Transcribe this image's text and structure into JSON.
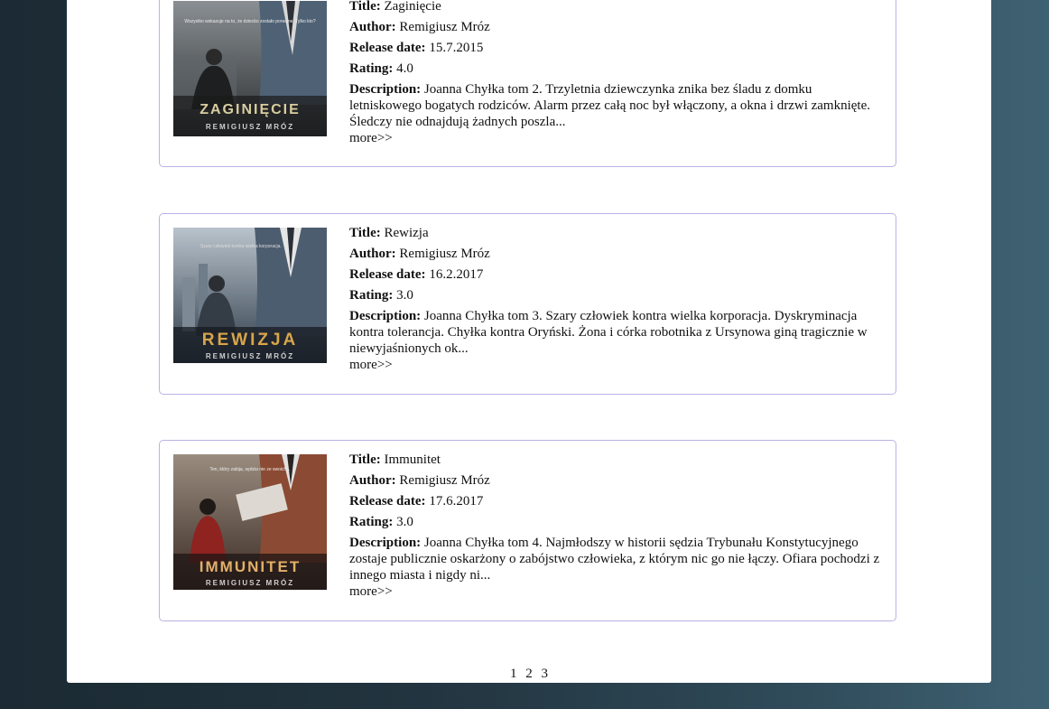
{
  "labels": {
    "title": "Title:",
    "author": "Author:",
    "release": "Release date:",
    "rating": "Rating:",
    "description": "Description:",
    "more": "more>>"
  },
  "books": [
    {
      "title": "Zaginięcie",
      "author": "Remigiusz Mróz",
      "release_date": "15.7.2015",
      "rating": "4.0",
      "description": "Joanna Chyłka tom 2. Trzyletnia dziewczynka znika bez śladu z domku letniskowego bogatych rodziców. Alarm przez całą noc był włączony, a okna i drzwi zamknięte. Śledczy nie odnajdują żadnych poszla...",
      "cover": {
        "title_text": "ZAGINIĘCIE",
        "author_text": "REMIGIUSZ MRÓZ",
        "tagline": "Wszystko wskazuje na to, że dziecko zostało porwane. Tylko kto?",
        "title_color": "#d9cda0",
        "bg_top": "#8a8f93",
        "bg_bottom": "#2a2e31"
      }
    },
    {
      "title": "Rewizja",
      "author": "Remigiusz Mróz",
      "release_date": "16.2.2017",
      "rating": "3.0",
      "description": "Joanna Chyłka tom 3. Szary człowiek kontra wielka korporacja. Dyskryminacja kontra tolerancja. Chyłka kontra Oryński. Żona i córka robotnika z Ursynowa giną tragicznie w niewyjaśnionych ok...",
      "cover": {
        "title_text": "REWIZJA",
        "author_text": "REMIGIUSZ MRÓZ",
        "tagline": "Szary człowiek kontra wielka korporacja.",
        "title_color": "#d8a54a",
        "bg_top": "#b9c3cc",
        "bg_bottom": "#2d3a48"
      }
    },
    {
      "title": "Immunitet",
      "author": "Remigiusz Mróz",
      "release_date": "17.6.2017",
      "rating": "3.0",
      "description": "Joanna Chyłka tom 4. Najmłodszy w historii sędzia Trybunału Konstytucyjnego zostaje publicznie oskarżony o zabójstwo człowieka, z którym nic go nie łączy. Ofiara pochodzi z innego miasta i nigdy ni...",
      "cover": {
        "title_text": "IMMUNITET",
        "author_text": "REMIGIUSZ MRÓZ",
        "tagline": "Ten, który zabija, sędzia nie ze swoich...",
        "title_color": "#e2b06a",
        "bg_top": "#9a8d7f",
        "bg_bottom": "#3a2a24"
      }
    }
  ],
  "pagination": [
    "1",
    "2",
    "3"
  ]
}
